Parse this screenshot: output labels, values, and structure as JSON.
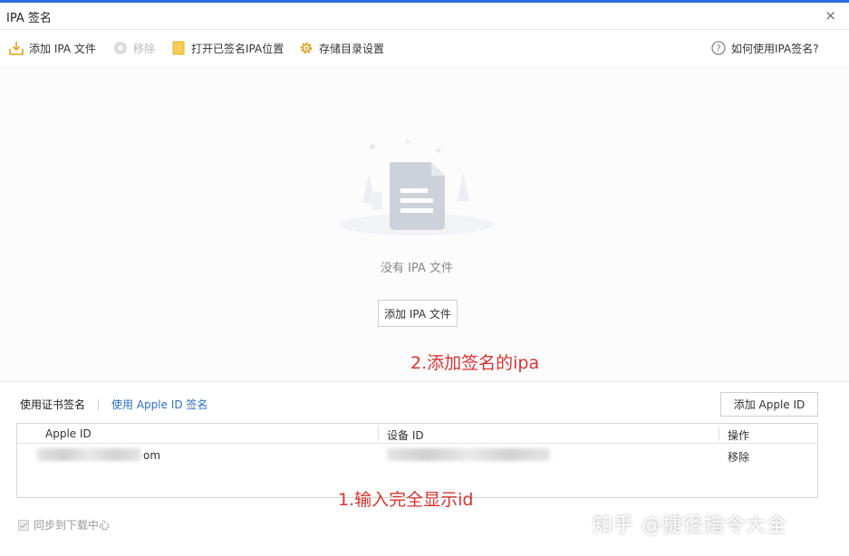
{
  "window": {
    "title": "IPA 签名",
    "close_glyph": "×"
  },
  "toolbar": {
    "add_ipa_label": "添加 IPA 文件",
    "remove_label": "移除",
    "open_signed_label": "打开已签名IPA位置",
    "storage_label": "存储目录设置",
    "help_label": "如何使用IPA签名?",
    "icons": {
      "add_ipa": "download-tray-icon",
      "remove": "remove-circle-icon",
      "open_signed": "folder-icon",
      "storage": "gear-icon",
      "help": "question-circle-icon"
    }
  },
  "empty_state": {
    "message": "没有 IPA 文件",
    "button_label": "添加 IPA 文件",
    "illustration": "document-icon"
  },
  "annotations": {
    "step2": "2.添加签名的ipa",
    "step1": "1.输入完全显示id",
    "color": "#d8332f"
  },
  "tabs": [
    {
      "label": "使用证书签名",
      "active": true
    },
    {
      "label": "使用 Apple ID 签名",
      "active": false
    }
  ],
  "add_apple_id_label": "添加 Apple ID",
  "table": {
    "columns": [
      "Apple ID",
      "设备 ID",
      "操作"
    ],
    "rows": [
      {
        "apple_id_visible": "om",
        "device_id_visible": "",
        "action": "移除"
      }
    ]
  },
  "footer": {
    "sync_label": "同步到下载中心",
    "sync_checked": true
  },
  "watermark": "知乎 @捷径指令大全",
  "colors": {
    "accent": "#2d6cdf",
    "link": "#2f6fc6",
    "annotation": "#d8332f"
  }
}
